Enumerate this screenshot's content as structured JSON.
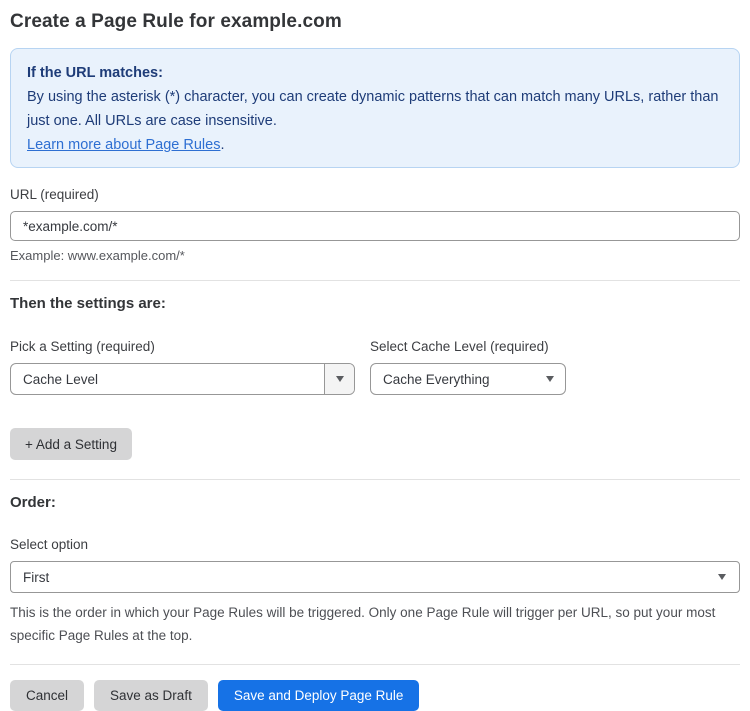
{
  "page": {
    "title": "Create a Page Rule for example.com"
  },
  "info_box": {
    "heading": "If the URL matches:",
    "body": "By using the asterisk (*) character, you can create dynamic patterns that can match many URLs, rather than just one. All URLs are case insensitive.",
    "link_label": "Learn more about Page Rules",
    "link_suffix": "."
  },
  "url_field": {
    "label": "URL (required)",
    "value": "*example.com/*",
    "helper": "Example: www.example.com/*"
  },
  "settings_section": {
    "heading": "Then the settings are:",
    "setting_select": {
      "label": "Pick a Setting (required)",
      "value": "Cache Level"
    },
    "cache_level_select": {
      "label": "Select Cache Level (required)",
      "value": "Cache Everything"
    },
    "add_setting_label": "+ Add a Setting"
  },
  "order_section": {
    "heading": "Order:",
    "select_label": "Select option",
    "select_value": "First",
    "helper": "This is the order in which your Page Rules will be triggered. Only one Page Rule will trigger per URL, so put your most specific Page Rules at the top."
  },
  "actions": {
    "cancel": "Cancel",
    "save_draft": "Save as Draft",
    "save_deploy": "Save and Deploy Page Rule"
  },
  "colors": {
    "info_background": "#e9f2fc",
    "info_border": "#b7d4f2",
    "info_text": "#1e3c78",
    "link_blue": "#2e6fd2",
    "primary_button_blue": "#1672e6",
    "gray_button": "#d5d5d6"
  }
}
